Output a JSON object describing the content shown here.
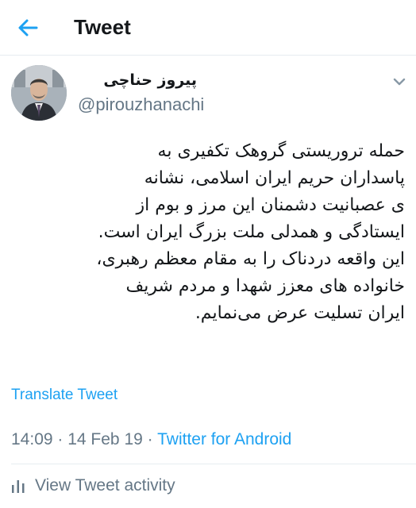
{
  "header": {
    "title": "Tweet",
    "back_icon": "arrow-left-icon"
  },
  "author": {
    "name": "پیروز حناچی",
    "handle": "@pirouzhanachi"
  },
  "tweet": {
    "lines": [
      "حمله تروریستی گروهک تکفیری به",
      "پاسداران حریم ایران اسلامی، نشانه",
      "ی عصبانیت دشمنان این مرز و بوم از",
      "ایستادگی و همدلی ملت بزرگ ایران است.",
      "این واقعه دردناک را به مقام معظم رهبری،",
      "خانواده های معزز شهدا و مردم شریف",
      "ایران تسلیت عرض می‌نمایم."
    ],
    "translate_label": "Translate Tweet"
  },
  "meta": {
    "time": "14:09",
    "separator_1": " · ",
    "date": "14 Feb 19",
    "separator_2": " · ",
    "source": "Twitter for Android"
  },
  "activity": {
    "label": "View Tweet activity",
    "icon": "bar-chart-icon"
  },
  "colors": {
    "accent": "#1da1f2",
    "text": "#14171a",
    "muted": "#657786",
    "divider": "#e6ecf0"
  }
}
